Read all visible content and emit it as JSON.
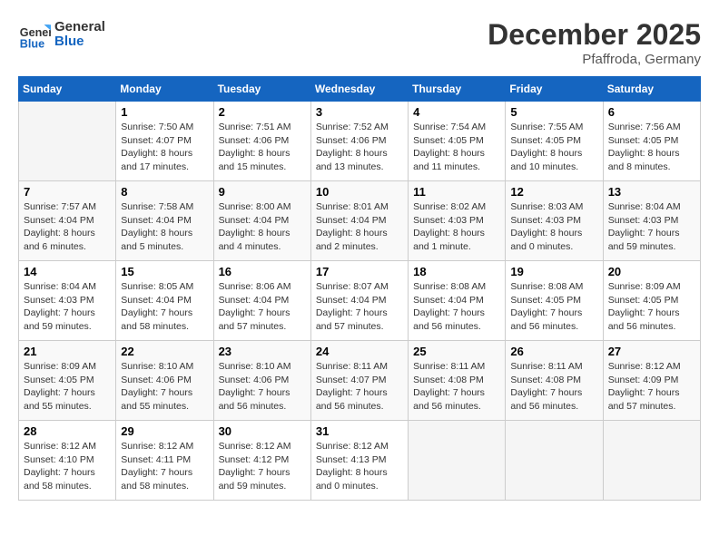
{
  "header": {
    "logo_line1": "General",
    "logo_line2": "Blue",
    "month": "December 2025",
    "location": "Pfaffroda, Germany"
  },
  "days_of_week": [
    "Sunday",
    "Monday",
    "Tuesday",
    "Wednesday",
    "Thursday",
    "Friday",
    "Saturday"
  ],
  "weeks": [
    [
      {
        "day": "",
        "info": ""
      },
      {
        "day": "1",
        "info": "Sunrise: 7:50 AM\nSunset: 4:07 PM\nDaylight: 8 hours\nand 17 minutes."
      },
      {
        "day": "2",
        "info": "Sunrise: 7:51 AM\nSunset: 4:06 PM\nDaylight: 8 hours\nand 15 minutes."
      },
      {
        "day": "3",
        "info": "Sunrise: 7:52 AM\nSunset: 4:06 PM\nDaylight: 8 hours\nand 13 minutes."
      },
      {
        "day": "4",
        "info": "Sunrise: 7:54 AM\nSunset: 4:05 PM\nDaylight: 8 hours\nand 11 minutes."
      },
      {
        "day": "5",
        "info": "Sunrise: 7:55 AM\nSunset: 4:05 PM\nDaylight: 8 hours\nand 10 minutes."
      },
      {
        "day": "6",
        "info": "Sunrise: 7:56 AM\nSunset: 4:05 PM\nDaylight: 8 hours\nand 8 minutes."
      }
    ],
    [
      {
        "day": "7",
        "info": "Sunrise: 7:57 AM\nSunset: 4:04 PM\nDaylight: 8 hours\nand 6 minutes."
      },
      {
        "day": "8",
        "info": "Sunrise: 7:58 AM\nSunset: 4:04 PM\nDaylight: 8 hours\nand 5 minutes."
      },
      {
        "day": "9",
        "info": "Sunrise: 8:00 AM\nSunset: 4:04 PM\nDaylight: 8 hours\nand 4 minutes."
      },
      {
        "day": "10",
        "info": "Sunrise: 8:01 AM\nSunset: 4:04 PM\nDaylight: 8 hours\nand 2 minutes."
      },
      {
        "day": "11",
        "info": "Sunrise: 8:02 AM\nSunset: 4:03 PM\nDaylight: 8 hours\nand 1 minute."
      },
      {
        "day": "12",
        "info": "Sunrise: 8:03 AM\nSunset: 4:03 PM\nDaylight: 8 hours\nand 0 minutes."
      },
      {
        "day": "13",
        "info": "Sunrise: 8:04 AM\nSunset: 4:03 PM\nDaylight: 7 hours\nand 59 minutes."
      }
    ],
    [
      {
        "day": "14",
        "info": "Sunrise: 8:04 AM\nSunset: 4:03 PM\nDaylight: 7 hours\nand 59 minutes."
      },
      {
        "day": "15",
        "info": "Sunrise: 8:05 AM\nSunset: 4:04 PM\nDaylight: 7 hours\nand 58 minutes."
      },
      {
        "day": "16",
        "info": "Sunrise: 8:06 AM\nSunset: 4:04 PM\nDaylight: 7 hours\nand 57 minutes."
      },
      {
        "day": "17",
        "info": "Sunrise: 8:07 AM\nSunset: 4:04 PM\nDaylight: 7 hours\nand 57 minutes."
      },
      {
        "day": "18",
        "info": "Sunrise: 8:08 AM\nSunset: 4:04 PM\nDaylight: 7 hours\nand 56 minutes."
      },
      {
        "day": "19",
        "info": "Sunrise: 8:08 AM\nSunset: 4:05 PM\nDaylight: 7 hours\nand 56 minutes."
      },
      {
        "day": "20",
        "info": "Sunrise: 8:09 AM\nSunset: 4:05 PM\nDaylight: 7 hours\nand 56 minutes."
      }
    ],
    [
      {
        "day": "21",
        "info": "Sunrise: 8:09 AM\nSunset: 4:05 PM\nDaylight: 7 hours\nand 55 minutes."
      },
      {
        "day": "22",
        "info": "Sunrise: 8:10 AM\nSunset: 4:06 PM\nDaylight: 7 hours\nand 55 minutes."
      },
      {
        "day": "23",
        "info": "Sunrise: 8:10 AM\nSunset: 4:06 PM\nDaylight: 7 hours\nand 56 minutes."
      },
      {
        "day": "24",
        "info": "Sunrise: 8:11 AM\nSunset: 4:07 PM\nDaylight: 7 hours\nand 56 minutes."
      },
      {
        "day": "25",
        "info": "Sunrise: 8:11 AM\nSunset: 4:08 PM\nDaylight: 7 hours\nand 56 minutes."
      },
      {
        "day": "26",
        "info": "Sunrise: 8:11 AM\nSunset: 4:08 PM\nDaylight: 7 hours\nand 56 minutes."
      },
      {
        "day": "27",
        "info": "Sunrise: 8:12 AM\nSunset: 4:09 PM\nDaylight: 7 hours\nand 57 minutes."
      }
    ],
    [
      {
        "day": "28",
        "info": "Sunrise: 8:12 AM\nSunset: 4:10 PM\nDaylight: 7 hours\nand 58 minutes."
      },
      {
        "day": "29",
        "info": "Sunrise: 8:12 AM\nSunset: 4:11 PM\nDaylight: 7 hours\nand 58 minutes."
      },
      {
        "day": "30",
        "info": "Sunrise: 8:12 AM\nSunset: 4:12 PM\nDaylight: 7 hours\nand 59 minutes."
      },
      {
        "day": "31",
        "info": "Sunrise: 8:12 AM\nSunset: 4:13 PM\nDaylight: 8 hours\nand 0 minutes."
      },
      {
        "day": "",
        "info": ""
      },
      {
        "day": "",
        "info": ""
      },
      {
        "day": "",
        "info": ""
      }
    ]
  ]
}
